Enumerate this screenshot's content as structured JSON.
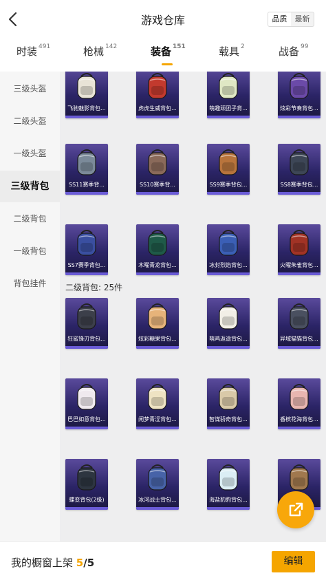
{
  "header": {
    "title": "游戏仓库",
    "sort_options": [
      "品质",
      "最新"
    ],
    "active_sort": "品质"
  },
  "tabs": [
    {
      "label": "时装",
      "count": "491"
    },
    {
      "label": "枪械",
      "count": "142"
    },
    {
      "label": "装备",
      "count": "151",
      "active": true
    },
    {
      "label": "载具",
      "count": "2"
    },
    {
      "label": "战备",
      "count": "99"
    }
  ],
  "sidebar": {
    "items": [
      "三级头盔",
      "二级头盔",
      "一级头盔",
      "三级背包",
      "二级背包",
      "一级背包",
      "背包挂件"
    ],
    "active": "三级背包"
  },
  "sections": {
    "level3_items": [
      {
        "name": "飞驰魅影背包...",
        "icon": "white-gold-backpack-icon",
        "color": "#e8e3d6"
      },
      {
        "name": "虎虎生威背包...",
        "icon": "red-tiger-backpack-icon",
        "color": "#c23a2e"
      },
      {
        "name": "萌趣顽团子背...",
        "icon": "cute-green-creature-backpack-icon",
        "color": "#dfe7c4"
      },
      {
        "name": "炫彩节奏背包...",
        "icon": "purple-festive-backpack-icon",
        "color": "#6b4aa8"
      },
      {
        "name": "SS11赛季背...",
        "icon": "grey-tactical-backpack-icon",
        "color": "#7b8a99"
      },
      {
        "name": "SS10赛季背...",
        "icon": "brown-tactical-backpack-icon",
        "color": "#8a6a5a"
      },
      {
        "name": "SS9赛季背包...",
        "icon": "orange-tactical-backpack-icon",
        "color": "#b8743c"
      },
      {
        "name": "SS8赛季背包...",
        "icon": "dark-tactical-backpack-icon",
        "color": "#3d4656"
      },
      {
        "name": "SS7赛季背包...",
        "icon": "blue-tactical-backpack-icon",
        "color": "#3a4fa0"
      },
      {
        "name": "木曜青龙背包...",
        "icon": "green-dragon-backpack-icon",
        "color": "#1f5a48"
      },
      {
        "name": "冰封烈焰背包...",
        "icon": "ice-flame-backpack-icon",
        "color": "#3b5fb5"
      },
      {
        "name": "火曜朱雀背包...",
        "icon": "red-phoenix-backpack-icon",
        "color": "#a13325"
      }
    ],
    "level2_title": "二级背包: 25件",
    "level2_items": [
      {
        "name": "狂鲨锋刃背包...",
        "icon": "shark-blade-backpack-icon",
        "color": "#3c3f4a"
      },
      {
        "name": "炫彩糖果背包...",
        "icon": "candy-backpack-icon",
        "color": "#e6b37a"
      },
      {
        "name": "萌鸡返途背包...",
        "icon": "cute-chick-backpack-icon",
        "color": "#f2efe6"
      },
      {
        "name": "异域猫猫背包...",
        "icon": "cat-backpack-icon",
        "color": "#4a5060"
      },
      {
        "name": "巴巴如意背包...",
        "icon": "white-bunny-backpack-icon",
        "color": "#efe9ee"
      },
      {
        "name": "闲梦青涩背包...",
        "icon": "white-gold-round-backpack-icon",
        "color": "#eee3c3"
      },
      {
        "name": "智谋骄奇背包...",
        "icon": "owl-backpack-icon",
        "color": "#d9c9a8"
      },
      {
        "name": "香槟花海背包...",
        "icon": "pink-flower-backpack-icon",
        "color": "#e8b6b0"
      },
      {
        "name": "蝶变背包(2级)",
        "icon": "black-butterfly-backpack-icon",
        "color": "#2d3540"
      },
      {
        "name": "冰河战士背包...",
        "icon": "ice-warrior-backpack-icon",
        "color": "#4763a8"
      },
      {
        "name": "海盐豹豹背包...",
        "icon": "seal-backpack-icon",
        "color": "#dbeef4"
      },
      {
        "name": "",
        "icon": "brown-strap-backpack-icon",
        "color": "#a0784e"
      }
    ]
  },
  "bottom": {
    "label": "我的橱窗上架",
    "current": "5",
    "total": "/5",
    "edit_label": "编辑"
  },
  "colors": {
    "accent": "#f5a500",
    "card_bg": "#2b2466"
  }
}
